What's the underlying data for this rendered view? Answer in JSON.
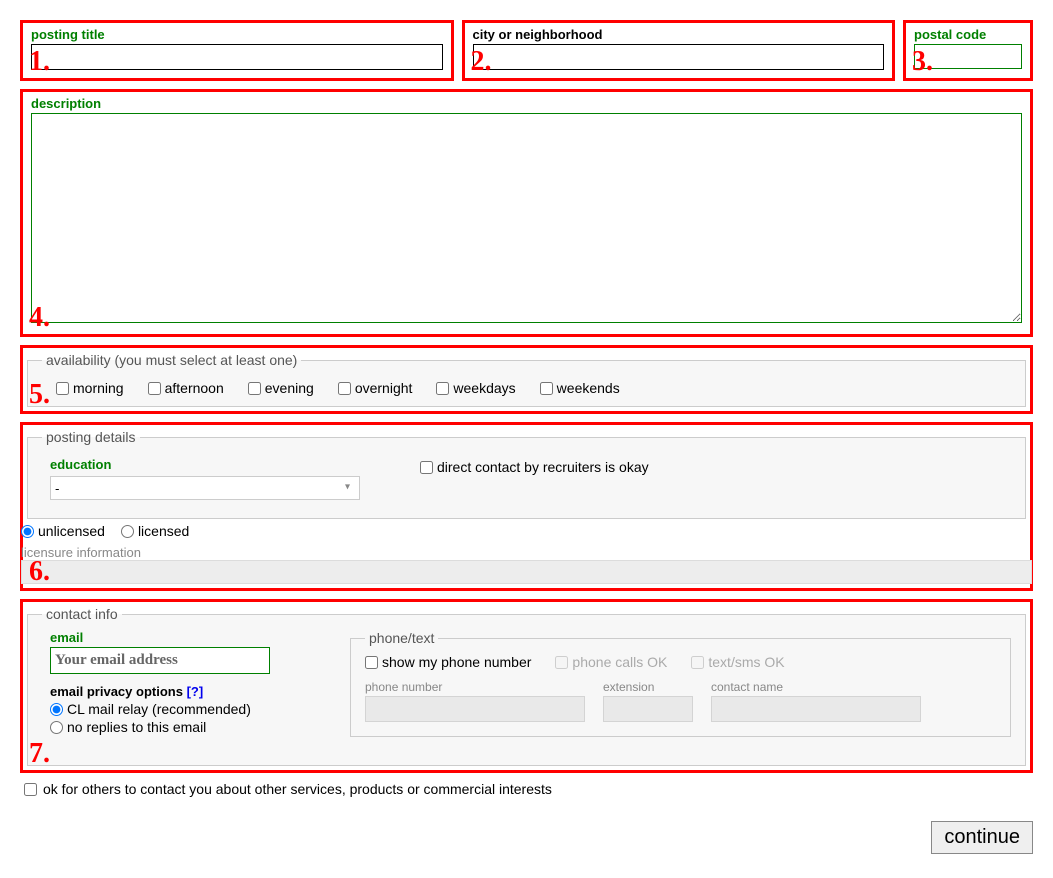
{
  "red_numbers": [
    "1.",
    "2.",
    "3.",
    "4.",
    "5.",
    "6.",
    "7."
  ],
  "title": {
    "label": "posting title"
  },
  "city": {
    "label": "city or neighborhood"
  },
  "postal": {
    "label": "postal code"
  },
  "description": {
    "label": "description"
  },
  "availability": {
    "legend": "availability (you must select at least one)",
    "options": [
      "morning",
      "afternoon",
      "evening",
      "overnight",
      "weekdays",
      "weekends"
    ]
  },
  "posting_details": {
    "legend": "posting details",
    "education_label": "education",
    "education_value": "-",
    "recruiters_label": "direct contact by recruiters is okay",
    "license": {
      "unlicensed": "unlicensed",
      "licensed": "licensed",
      "selected": "unlicensed"
    },
    "licensure_label": "licensure information"
  },
  "contact": {
    "legend": "contact info",
    "email_label": "email",
    "email_placeholder": "Your email address",
    "privacy_label": "email privacy options",
    "privacy_help": "[?]",
    "privacy_options": {
      "relay": "CL mail relay (recommended)",
      "noreply": "no replies to this email",
      "selected": "relay"
    },
    "phone": {
      "legend": "phone/text",
      "show_label": "show my phone number",
      "calls_label": "phone calls OK",
      "text_label": "text/sms OK",
      "phone_number_label": "phone number",
      "extension_label": "extension",
      "contact_name_label": "contact name"
    }
  },
  "ok_others_label": "ok for others to contact you about other services, products or commercial interests",
  "continue_label": "continue"
}
